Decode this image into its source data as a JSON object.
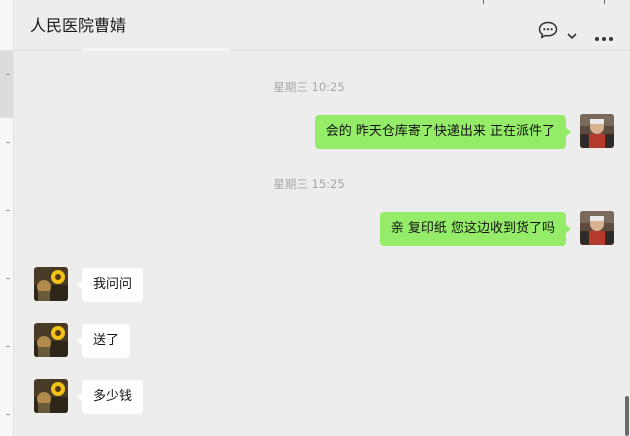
{
  "chat": {
    "title": "人民医院曹婧",
    "messages": [
      {
        "type": "timestamp",
        "text": "星期三 10:25"
      },
      {
        "type": "outgoing",
        "text": "会的 昨天仓库寄了快递出来 正在派件了"
      },
      {
        "type": "timestamp",
        "text": "星期三 15:25"
      },
      {
        "type": "outgoing",
        "text": "亲 复印纸 您这边收到货了吗"
      },
      {
        "type": "incoming",
        "text": "我问问"
      },
      {
        "type": "incoming",
        "text": "送了"
      },
      {
        "type": "incoming",
        "text": "多少钱"
      }
    ]
  },
  "header_icons": {
    "chat": "chat-bubble-icon",
    "dropdown": "chevron-down-icon",
    "more": "more-dots-icon"
  },
  "colors": {
    "background": "#ededed",
    "outgoing_bubble": "#95ec69",
    "incoming_bubble": "#ffffff",
    "timestamp": "#a6a6a6"
  }
}
